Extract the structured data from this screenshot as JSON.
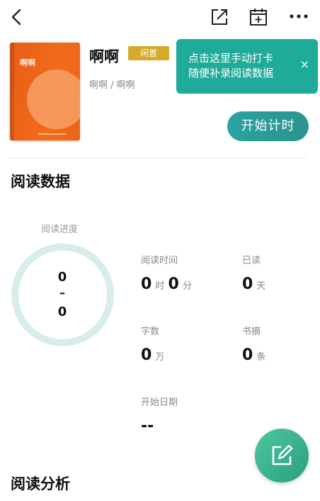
{
  "book": {
    "title": "啊啊",
    "tag": "闲置",
    "author": "啊啊 / 啊啊",
    "cover_title": "啊啊"
  },
  "tooltip": {
    "line1": "点击这里手动打卡",
    "line2": "随便补录阅读数据",
    "close": "×"
  },
  "start_button": "开始计时",
  "sections": {
    "reading_data": "阅读数据",
    "reading_analysis": "阅读分析"
  },
  "progress": {
    "label": "阅读进度",
    "current": "0",
    "separator": "–",
    "total": "0"
  },
  "stats": {
    "reading_time": {
      "label": "阅读时间",
      "hours": "0",
      "hours_unit": "时",
      "minutes": "0",
      "minutes_unit": "分"
    },
    "days_read": {
      "label": "已读",
      "value": "0",
      "unit": "天"
    },
    "word_count": {
      "label": "字数",
      "value": "0",
      "unit": "万"
    },
    "excerpts": {
      "label": "书摘",
      "value": "0",
      "unit": "条"
    },
    "start_date": {
      "label": "开始日期",
      "value": "--"
    }
  },
  "icons": {
    "back": "chevron-left-icon",
    "share": "share-external-icon",
    "calendar": "calendar-add-icon",
    "more": "more-horizontal-icon",
    "fab": "edit-icon"
  },
  "colors": {
    "accent": "#1fab9a",
    "tag": "#d4a92c",
    "cover": "#f26b1c",
    "ring": "#d8ecec"
  }
}
